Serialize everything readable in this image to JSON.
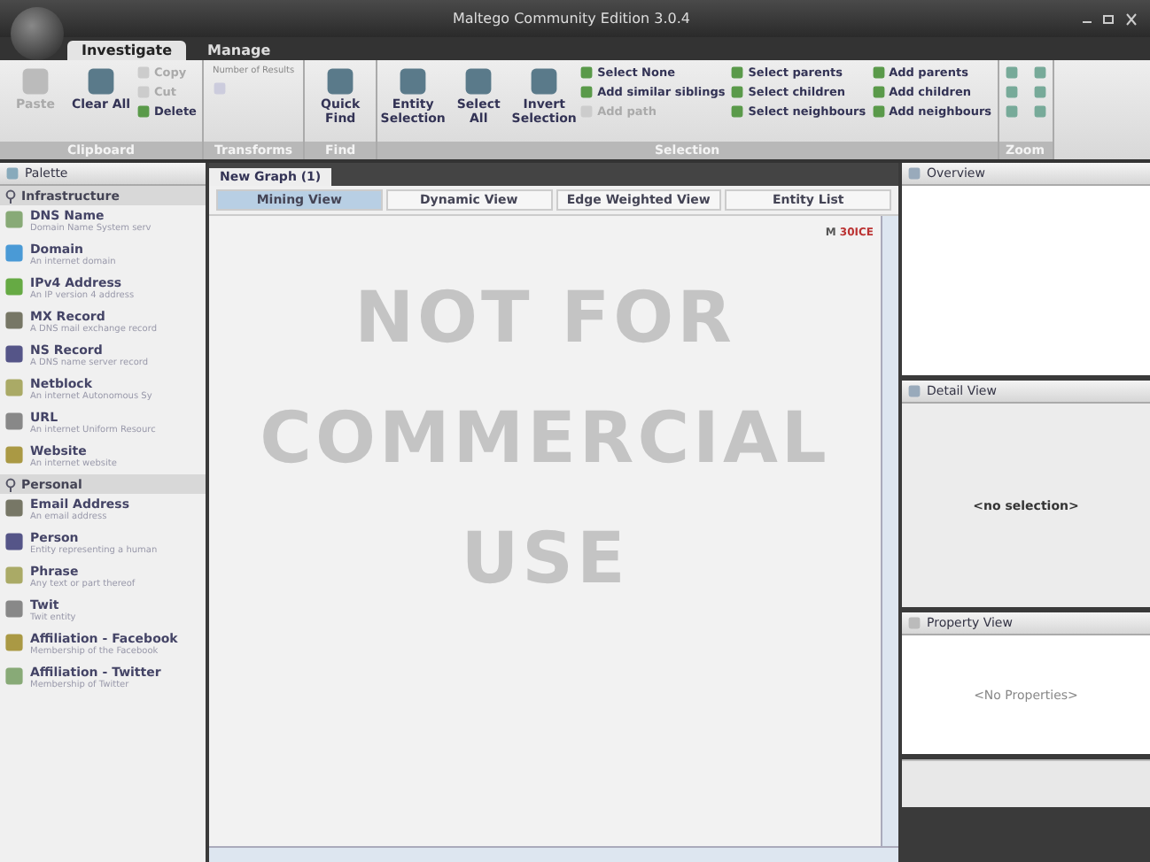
{
  "window": {
    "title": "Maltego Community Edition 3.0.4"
  },
  "ribbon_tabs": [
    {
      "label": "Investigate",
      "selected": true
    },
    {
      "label": "Manage",
      "selected": false
    }
  ],
  "ribbon_groups": [
    {
      "label": "Clipboard",
      "items": [
        {
          "kind": "big",
          "label": "Paste",
          "disabled": true
        },
        {
          "kind": "big",
          "label": "Clear All",
          "disabled": false
        },
        {
          "kind": "stack",
          "entries": [
            {
              "label": "Copy",
              "disabled": true
            },
            {
              "label": "Cut",
              "disabled": true
            },
            {
              "label": "Delete",
              "disabled": false
            }
          ]
        }
      ]
    },
    {
      "label": "Transforms",
      "items": [
        {
          "kind": "spinner",
          "label": "Number of Results",
          "disabled": true
        }
      ]
    },
    {
      "label": "Find",
      "items": [
        {
          "kind": "big",
          "label": "Quick Find",
          "disabled": false
        }
      ]
    },
    {
      "label": "Selection",
      "items": [
        {
          "kind": "big",
          "label": "Entity Selection",
          "disabled": false
        },
        {
          "kind": "big",
          "label": "Select All",
          "disabled": false
        },
        {
          "kind": "big",
          "label": "Invert Selection",
          "disabled": false
        },
        {
          "kind": "stack",
          "entries": [
            {
              "label": "Select None",
              "disabled": false
            },
            {
              "label": "Add similar siblings",
              "disabled": false
            },
            {
              "label": "Add path",
              "disabled": true
            }
          ]
        },
        {
          "kind": "stack",
          "entries": [
            {
              "label": "Select parents",
              "disabled": false
            },
            {
              "label": "Select children",
              "disabled": false
            },
            {
              "label": "Select neighbours",
              "disabled": false
            }
          ]
        },
        {
          "kind": "stack",
          "entries": [
            {
              "label": "Add parents",
              "disabled": false
            },
            {
              "label": "Add children",
              "disabled": false
            },
            {
              "label": "Add neighbours",
              "disabled": false
            }
          ]
        }
      ]
    },
    {
      "label": "Zoom",
      "items": [
        {
          "kind": "zoom"
        }
      ]
    }
  ],
  "palette": {
    "title": "Palette",
    "categories": [
      {
        "label": "Infrastructure",
        "expanded": true,
        "children": [
          {
            "name": "DNS Name",
            "description": "Domain Name System serv"
          },
          {
            "name": "Domain",
            "description": "An internet domain"
          },
          {
            "name": "IPv4 Address",
            "description": "An IP version 4 address"
          },
          {
            "name": "MX Record",
            "description": "A DNS mail exchange record"
          },
          {
            "name": "NS Record",
            "description": "A DNS name server record"
          },
          {
            "name": "Netblock",
            "description": "An internet Autonomous Sy"
          },
          {
            "name": "URL",
            "description": "An internet Uniform Resourc"
          },
          {
            "name": "Website",
            "description": "An internet website"
          }
        ]
      },
      {
        "label": "Personal",
        "expanded": true,
        "children": [
          {
            "name": "Email Address",
            "description": "An email address"
          },
          {
            "name": "Person",
            "description": "Entity representing a human"
          },
          {
            "name": "Phrase",
            "description": "Any text or part thereof"
          },
          {
            "name": "Twit",
            "description": "Twit entity"
          },
          {
            "name": "Affiliation - Facebook",
            "description": "Membership of the Facebook"
          },
          {
            "name": "Affiliation - Twitter",
            "description": "Membership of Twitter"
          }
        ]
      }
    ]
  },
  "graph": {
    "tab": "New Graph (1)",
    "views": [
      {
        "label": "Mining View",
        "selected": true
      },
      {
        "label": "Dynamic View",
        "selected": false
      },
      {
        "label": "Edge Weighted View",
        "selected": false
      },
      {
        "label": "Entity List",
        "selected": false
      }
    ],
    "mode_prefix": "M ",
    "mode": "30ICE",
    "watermark": [
      "NOT FOR",
      "COMMERCIAL",
      "USE"
    ]
  },
  "overview": {
    "title": "Overview"
  },
  "detail_view": {
    "title": "Detail View",
    "empty": "<no selection>"
  },
  "property_view": {
    "title": "Property View",
    "empty": "<No Properties>"
  }
}
